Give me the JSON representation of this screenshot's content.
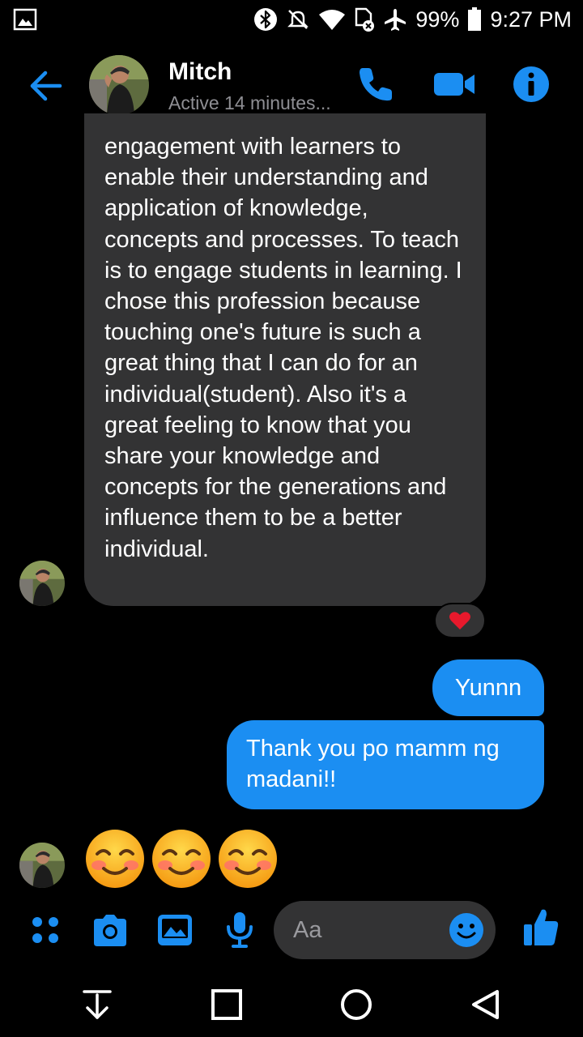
{
  "status_bar": {
    "battery": "99%",
    "time": "9:27 PM"
  },
  "header": {
    "contact_name": "Mitch",
    "contact_status": "Active 14 minutes..."
  },
  "messages": {
    "incoming_text": "engagement with learners to enable their understanding and application of knowledge, concepts and processes. To teach is to engage students in learning. I chose this profession because touching one's future is such a great thing that I can do for an individual(student). Also it's a great feeling to know that you share your knowledge and concepts for the generations and influence them to be a better individual.",
    "reaction": "❤️",
    "outgoing": [
      "Yunnn",
      "Thank you po mamm ng madani!!"
    ],
    "emojis": [
      "☺️",
      "☺️",
      "☺️"
    ]
  },
  "composer": {
    "placeholder": "Aa"
  },
  "colors": {
    "accent": "#1b8ef2",
    "incoming_bubble": "#333334",
    "background": "#000000"
  }
}
